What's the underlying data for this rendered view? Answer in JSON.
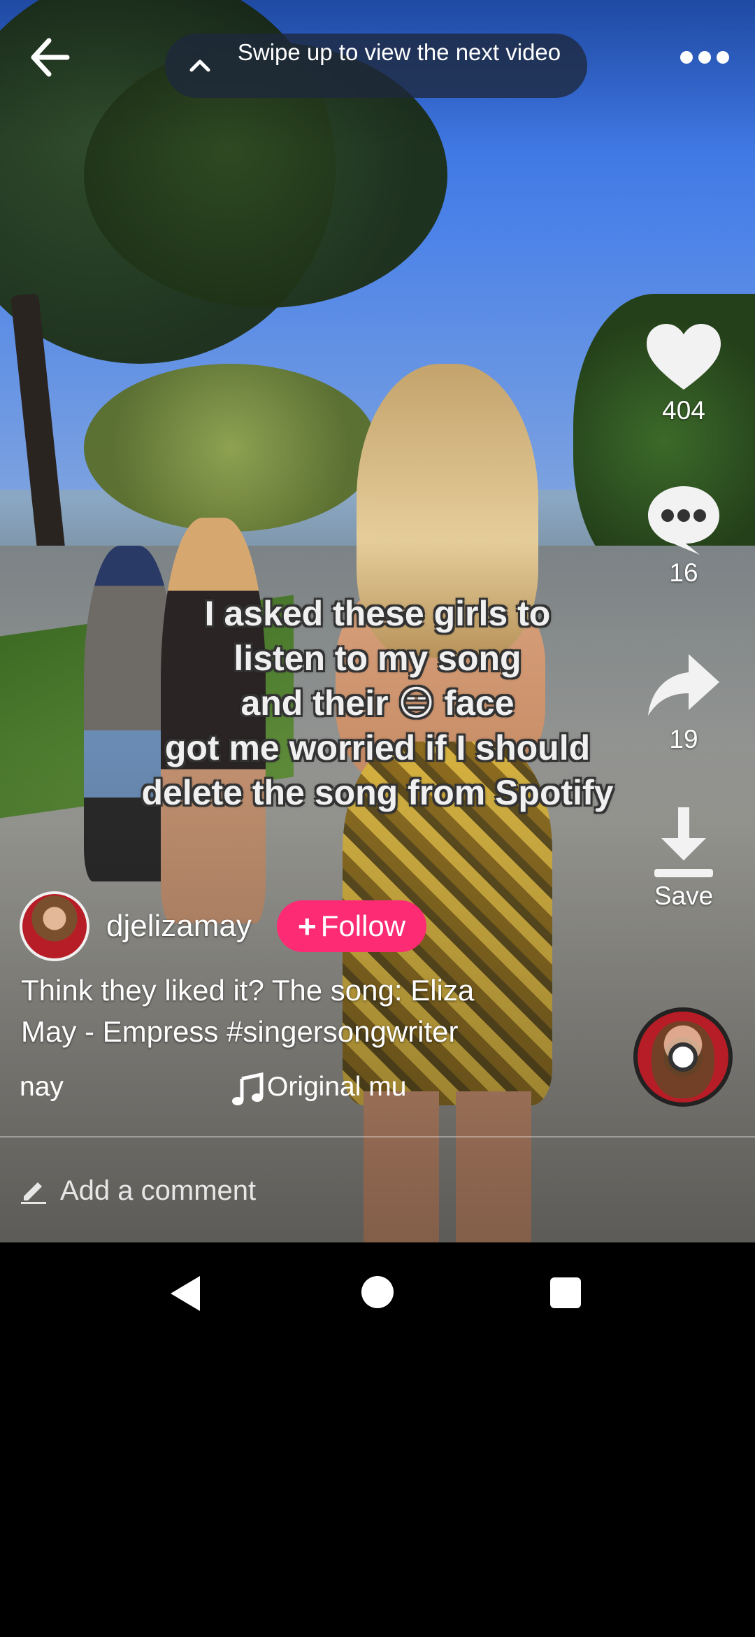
{
  "top_bar": {
    "swipe_hint": "Swipe up to view the next video"
  },
  "video": {
    "caption_lines": [
      "I asked these girls to",
      "listen to my song",
      "and their 😑 face",
      "got me worried if I should",
      "delete the song from Spotify"
    ]
  },
  "actions": {
    "likes": "404",
    "comments": "16",
    "shares": "19",
    "save_label": "Save"
  },
  "author": {
    "username": "djelizamay",
    "follow_label": "Follow",
    "follow_color": "#fc2b73"
  },
  "post": {
    "description": "Think they liked it? The song: Eliza May - Empress #singersongwriter"
  },
  "music": {
    "scroll_left": "nay",
    "scroll_text": "Original mu"
  },
  "comment_bar": {
    "placeholder": "Add a comment"
  },
  "icons": [
    "back-arrow-icon",
    "chevron-up-icon",
    "more-icon",
    "heart-icon",
    "comment-bubble-icon",
    "share-arrow-icon",
    "download-icon",
    "music-note-icon",
    "pencil-icon",
    "nav-back-icon",
    "nav-home-icon",
    "nav-recents-icon"
  ]
}
